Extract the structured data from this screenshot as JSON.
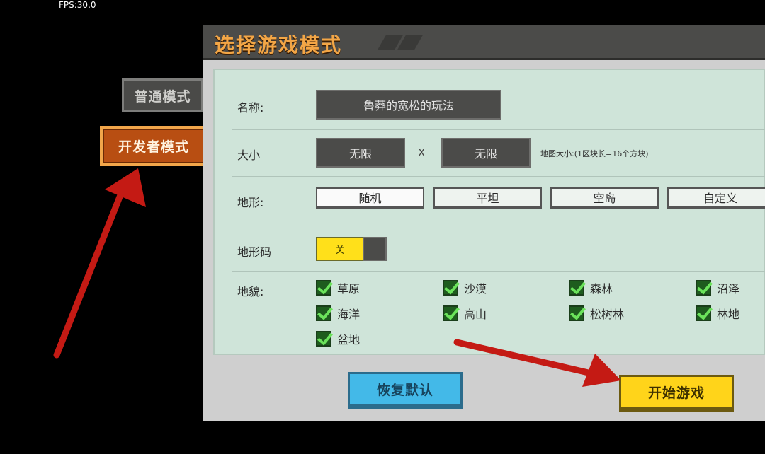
{
  "hud": {
    "fps": "FPS:30.0"
  },
  "modes": {
    "normal": "普通模式",
    "developer": "开发者模式"
  },
  "dialog": {
    "title": "选择游戏模式",
    "name_label": "名称:",
    "name_value": "鲁莽的宽松的玩法",
    "size_label": "大小",
    "size_width": "无限",
    "size_sep": "X",
    "size_height": "无限",
    "size_hint": "地图大小:(1区块长=16个方块)",
    "terrain_label": "地形:",
    "terrain_options": [
      "随机",
      "平坦",
      "空岛",
      "自定义"
    ],
    "terrain_selected": "随机",
    "terrain_code_label": "地形码",
    "terrain_code_toggle": "关",
    "biome_label": "地貌:",
    "biomes": [
      "草原",
      "沙漠",
      "森林",
      "沼泽",
      "海洋",
      "高山",
      "松树林",
      "林地",
      "盆地"
    ],
    "reset_button": "恢复默认",
    "start_button": "开始游戏"
  },
  "colors": {
    "developer_tab": "#b84e12",
    "title": "#f3a646",
    "panel": "#cfe4d9",
    "toggle": "#ffe01a",
    "reset": "#43b9e8",
    "start": "#ffd41a",
    "arrow": "#c41a14"
  }
}
